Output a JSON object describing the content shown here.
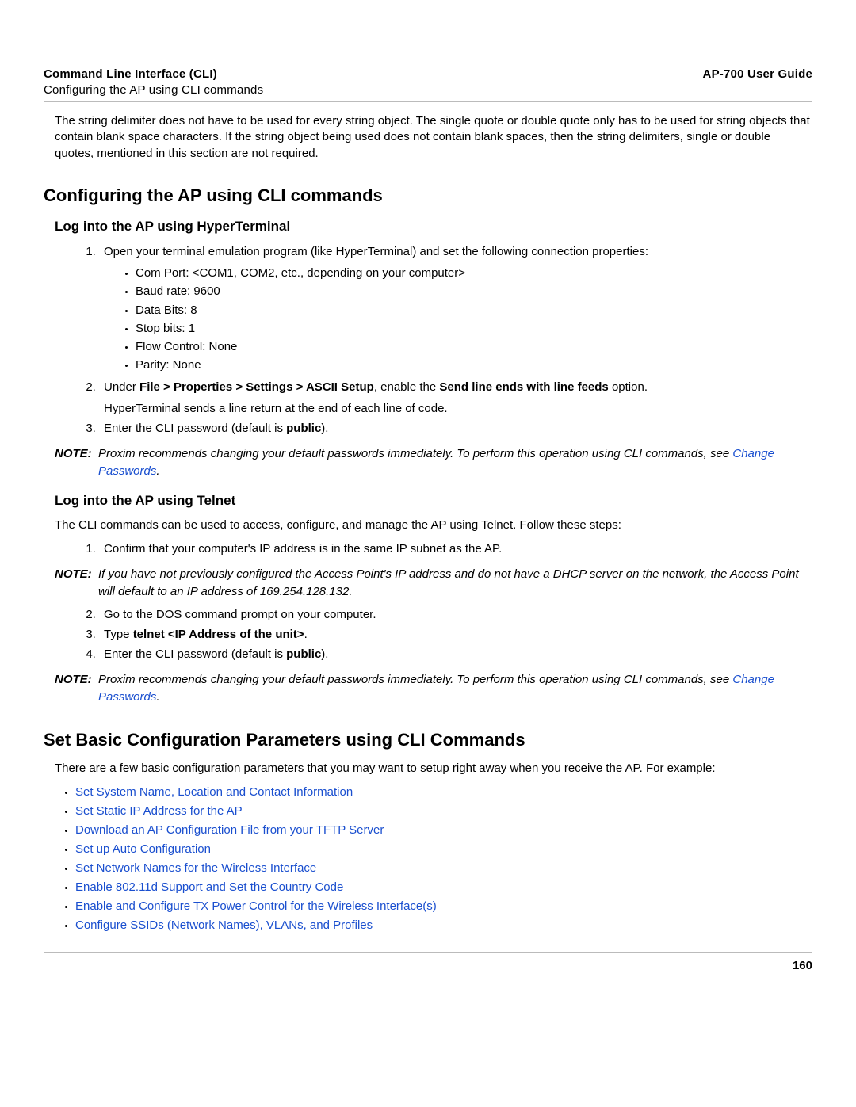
{
  "header": {
    "left": "Command Line Interface (CLI)",
    "right": "AP-700 User Guide",
    "sub": "Configuring the AP using CLI commands"
  },
  "intro": "The string delimiter does not have to be used for every string object. The single quote or double quote only has to be used for string objects that contain blank space characters. If the string object being used does not contain blank spaces, then the string delimiters, single or double quotes, mentioned in this section are not required.",
  "section1": {
    "title": "Configuring the AP using CLI commands",
    "sub1": {
      "title": "Log into the AP using HyperTerminal",
      "li1": "Open your terminal emulation program (like HyperTerminal) and set the following connection properties:",
      "bullets": [
        "Com Port: <COM1, COM2, etc., depending on your computer>",
        "Baud rate: 9600",
        "Data Bits: 8",
        "Stop bits: 1",
        "Flow Control: None",
        "Parity: None"
      ],
      "li2a": "Under ",
      "li2b": "File > Properties > Settings > ASCII Setup",
      "li2c": ", enable the ",
      "li2d": "Send line ends with line feeds",
      "li2e": " option.",
      "li2f": "HyperTerminal sends a line return at the end of each line of code.",
      "li3a": "Enter the CLI password (default is ",
      "li3b": "public",
      "li3c": ")."
    },
    "note1": {
      "label": "NOTE:",
      "text": "Proxim recommends changing your default passwords immediately. To perform this operation using CLI commands, see ",
      "link": "Change Passwords",
      "after": "."
    },
    "sub2": {
      "title": "Log into the AP using Telnet",
      "lead": "The CLI commands can be used to access, configure, and manage the AP using Telnet. Follow these steps:",
      "li1": "Confirm that your computer's IP address is in the same IP subnet as the AP.",
      "note2": {
        "label": "NOTE:",
        "text": "If you have not previously configured the Access Point's IP address and do not have a DHCP server on the network, the Access Point will default to an IP address of 169.254.128.132."
      },
      "li2": "Go to the DOS command prompt on your computer.",
      "li3a": "Type ",
      "li3b": "telnet <IP Address of the unit>",
      "li3c": ".",
      "li4a": "Enter the CLI password (default is ",
      "li4b": "public",
      "li4c": ")."
    },
    "note3": {
      "label": "NOTE:",
      "text": "Proxim recommends changing your default passwords immediately. To perform this operation using CLI commands, see ",
      "link": "Change Passwords",
      "after": "."
    }
  },
  "section2": {
    "title": "Set Basic Configuration Parameters using CLI Commands",
    "lead": "There are a few basic configuration parameters that you may want to setup right away when you receive the AP. For example:",
    "links": [
      "Set System Name, Location and Contact Information",
      "Set Static IP Address for the AP",
      "Download an AP Configuration File from your TFTP Server",
      "Set up Auto Configuration",
      "Set Network Names for the Wireless Interface",
      "Enable 802.11d Support and Set the Country Code",
      "Enable and Configure TX Power Control for the Wireless Interface(s)",
      "Configure SSIDs (Network Names), VLANs, and Profiles"
    ]
  },
  "pagenum": "160"
}
